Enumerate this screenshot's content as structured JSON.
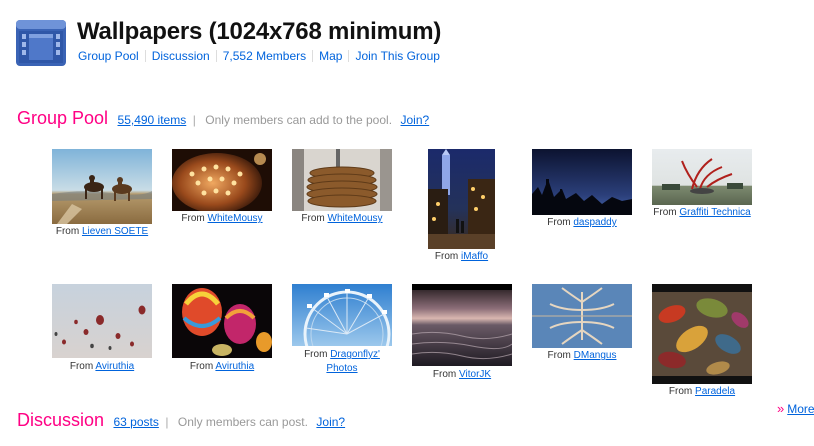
{
  "group": {
    "title": "Wallpapers (1024x768 minimum)",
    "nav": [
      "Group Pool",
      "Discussion",
      "7,552 Members",
      "Map",
      "Join This Group"
    ]
  },
  "pool": {
    "title": "Group Pool",
    "count": "55,490 items",
    "separator": "|",
    "note": "Only members can add to the pool.",
    "join": "Join?",
    "from": "From",
    "photos": [
      {
        "by": "Lieven SOETE"
      },
      {
        "by": "WhiteMousy"
      },
      {
        "by": "WhiteMousy"
      },
      {
        "by": "iMaffo"
      },
      {
        "by": "daspaddy"
      },
      {
        "by": "Graffiti Technica"
      },
      {
        "by": "Aviruthia"
      },
      {
        "by": "Aviruthia"
      },
      {
        "by": "Dragonflyz'",
        "by2": "Photos"
      },
      {
        "by": "VitorJK"
      },
      {
        "by": "DMangus"
      },
      {
        "by": "Paradela"
      }
    ]
  },
  "discussion": {
    "title": "Discussion",
    "count": "63 posts",
    "separator": "|",
    "note": "Only members can post.",
    "join": "Join?"
  },
  "more": {
    "arrow": "»",
    "label": "More"
  }
}
